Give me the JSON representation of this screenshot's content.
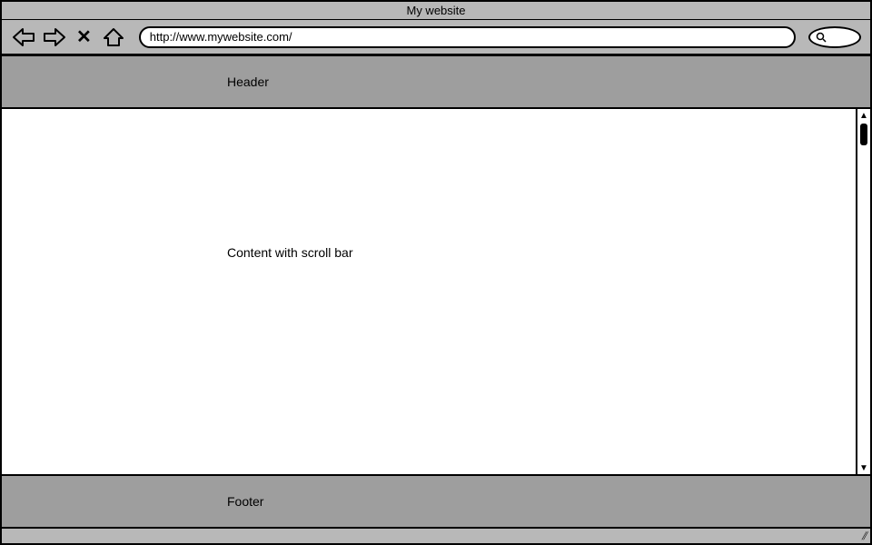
{
  "window": {
    "title": "My website"
  },
  "toolbar": {
    "url": "http://www.mywebsite.com/"
  },
  "page": {
    "header": "Header",
    "content": "Content with scroll bar",
    "footer": "Footer"
  }
}
